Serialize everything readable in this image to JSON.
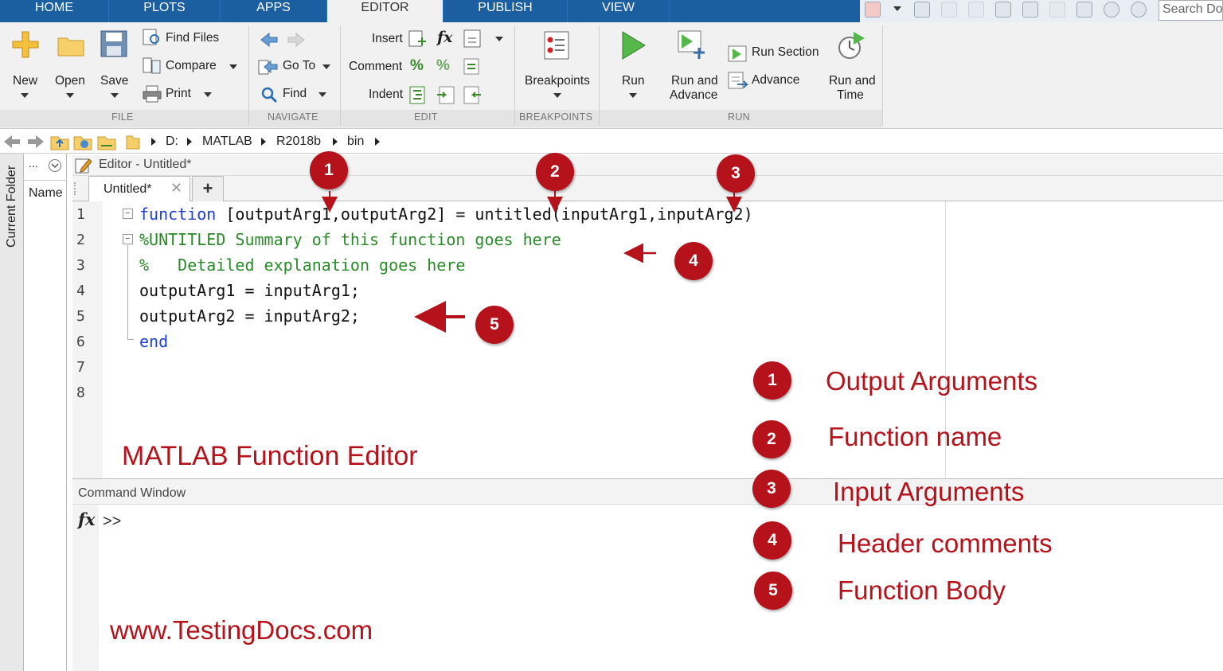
{
  "tabs": [
    "HOME",
    "PLOTS",
    "APPS",
    "EDITOR",
    "PUBLISH",
    "VIEW"
  ],
  "search_placeholder": "Search Do",
  "ribbon": {
    "file": {
      "new": "New",
      "open": "Open",
      "save": "Save",
      "find_files": "Find Files",
      "compare": "Compare",
      "print": "Print",
      "group": "FILE"
    },
    "navigate": {
      "go_to": "Go To",
      "find": "Find",
      "group": "NAVIGATE"
    },
    "edit": {
      "insert": "Insert",
      "comment": "Comment",
      "indent": "Indent",
      "group": "EDIT",
      "fx": "fx"
    },
    "breakpoints": {
      "label": "Breakpoints",
      "group": "BREAKPOINTS"
    },
    "run": {
      "run": "Run",
      "run_and_advance_1": "Run and",
      "run_and_advance_2": "Advance",
      "run_section": "Run Section",
      "advance": "Advance",
      "run_and_time_1": "Run and",
      "run_and_time_2": "Time",
      "group": "RUN"
    }
  },
  "path": [
    "D:",
    "MATLAB",
    "R2018b",
    "bin"
  ],
  "current_folder": {
    "side_label": "Current Folder",
    "ellipsis": "...",
    "name_col": "Name"
  },
  "editor": {
    "title": "Editor - Untitled*",
    "tab": "Untitled*",
    "new_tab": "+"
  },
  "code_lines": {
    "l1_kw": "function",
    "l1_rest": " [outputArg1,outputArg2] = untitled(inputArg1,inputArg2)",
    "l2": "%UNTITLED Summary of this function goes here",
    "l3": "%   Detailed explanation goes here",
    "l4": "outputArg1 = inputArg1;",
    "l5": "outputArg2 = inputArg2;",
    "l6": "end"
  },
  "line_numbers": [
    "1",
    "2",
    "3",
    "4",
    "5",
    "6",
    "7",
    "8"
  ],
  "command_window": {
    "title": "Command Window",
    "fx": "fx",
    "prompt": ">>"
  },
  "annotations": {
    "editor_caption": "MATLAB Function Editor",
    "website": "www.TestingDocs.com",
    "badges": [
      "1",
      "2",
      "3",
      "4",
      "5"
    ],
    "legend": [
      {
        "num": "1",
        "text": "Output Arguments"
      },
      {
        "num": "2",
        "text": "Function name"
      },
      {
        "num": "3",
        "text": "Input Arguments"
      },
      {
        "num": "4",
        "text": "Header comments"
      },
      {
        "num": "5",
        "text": "Function Body"
      }
    ]
  },
  "colors": {
    "accent_red": "#b5121b",
    "tab_blue": "#1b5fa0",
    "keyword": "#1f3fd6",
    "comment": "#2a8a2a"
  }
}
